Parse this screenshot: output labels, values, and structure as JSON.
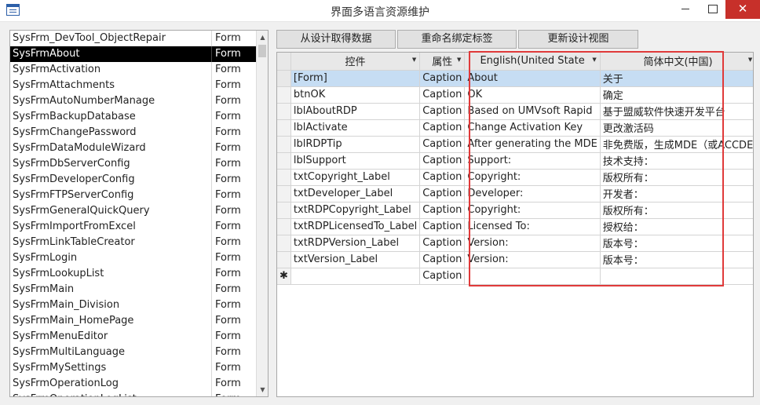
{
  "window": {
    "title": "界面多语言资源维护",
    "close_glyph": "✕"
  },
  "form_list": {
    "selected_index": 1,
    "items": [
      {
        "name": "SysFrm_DevTool_ObjectRepair",
        "type": "Form"
      },
      {
        "name": "SysFrmAbout",
        "type": "Form"
      },
      {
        "name": "SysFrmActivation",
        "type": "Form"
      },
      {
        "name": "SysFrmAttachments",
        "type": "Form"
      },
      {
        "name": "SysFrmAutoNumberManage",
        "type": "Form"
      },
      {
        "name": "SysFrmBackupDatabase",
        "type": "Form"
      },
      {
        "name": "SysFrmChangePassword",
        "type": "Form"
      },
      {
        "name": "SysFrmDataModuleWizard",
        "type": "Form"
      },
      {
        "name": "SysFrmDbServerConfig",
        "type": "Form"
      },
      {
        "name": "SysFrmDeveloperConfig",
        "type": "Form"
      },
      {
        "name": "SysFrmFTPServerConfig",
        "type": "Form"
      },
      {
        "name": "SysFrmGeneralQuickQuery",
        "type": "Form"
      },
      {
        "name": "SysFrmImportFromExcel",
        "type": "Form"
      },
      {
        "name": "SysFrmLinkTableCreator",
        "type": "Form"
      },
      {
        "name": "SysFrmLogin",
        "type": "Form"
      },
      {
        "name": "SysFrmLookupList",
        "type": "Form"
      },
      {
        "name": "SysFrmMain",
        "type": "Form"
      },
      {
        "name": "SysFrmMain_Division",
        "type": "Form"
      },
      {
        "name": "SysFrmMain_HomePage",
        "type": "Form"
      },
      {
        "name": "SysFrmMenuEditor",
        "type": "Form"
      },
      {
        "name": "SysFrmMultiLanguage",
        "type": "Form"
      },
      {
        "name": "SysFrmMySettings",
        "type": "Form"
      },
      {
        "name": "SysFrmOperationLog",
        "type": "Form"
      },
      {
        "name": "SysFrmOperationLogList",
        "type": "Form"
      }
    ]
  },
  "toolbar": {
    "fetch_label": "从设计取得数据",
    "rename_label": "重命名绑定标签",
    "update_label": "更新设计视图"
  },
  "grid": {
    "columns": [
      "控件",
      "属性",
      "English(United State",
      "简体中文(中国)"
    ],
    "new_row_marker": "✱",
    "new_row_attr": "Caption",
    "rows": [
      {
        "control": "[Form]",
        "attr": "Caption",
        "en": "About",
        "zh": "关于"
      },
      {
        "control": "btnOK",
        "attr": "Caption",
        "en": "OK",
        "zh": "确定"
      },
      {
        "control": "lblAboutRDP",
        "attr": "Caption",
        "en": "Based on UMVsoft Rapid",
        "zh": "基于盟威软件快速开发平台"
      },
      {
        "control": "lblActivate",
        "attr": "Caption",
        "en": "Change Activation Key",
        "zh": "更改激活码"
      },
      {
        "control": "lblRDPTip",
        "attr": "Caption",
        "en": "After generating the MDE",
        "zh": "非免费版，生成MDE（或ACCDE"
      },
      {
        "control": "lblSupport",
        "attr": "Caption",
        "en": "Support:",
        "zh": "技术支持："
      },
      {
        "control": "txtCopyright_Label",
        "attr": "Caption",
        "en": "Copyright:",
        "zh": "版权所有："
      },
      {
        "control": "txtDeveloper_Label",
        "attr": "Caption",
        "en": "Developer:",
        "zh": "开发者："
      },
      {
        "control": "txtRDPCopyright_Label",
        "attr": "Caption",
        "en": "Copyright:",
        "zh": "版权所有："
      },
      {
        "control": "txtRDPLicensedTo_Label",
        "attr": "Caption",
        "en": "Licensed To:",
        "zh": "授权给："
      },
      {
        "control": "txtRDPVersion_Label",
        "attr": "Caption",
        "en": "Version:",
        "zh": "版本号："
      },
      {
        "control": "txtVersion_Label",
        "attr": "Caption",
        "en": "Version:",
        "zh": "版本号："
      }
    ]
  },
  "colors": {
    "highlight_box": "#e03a3a",
    "current_row": "#c6ddf3",
    "selected_item": "#000000"
  }
}
